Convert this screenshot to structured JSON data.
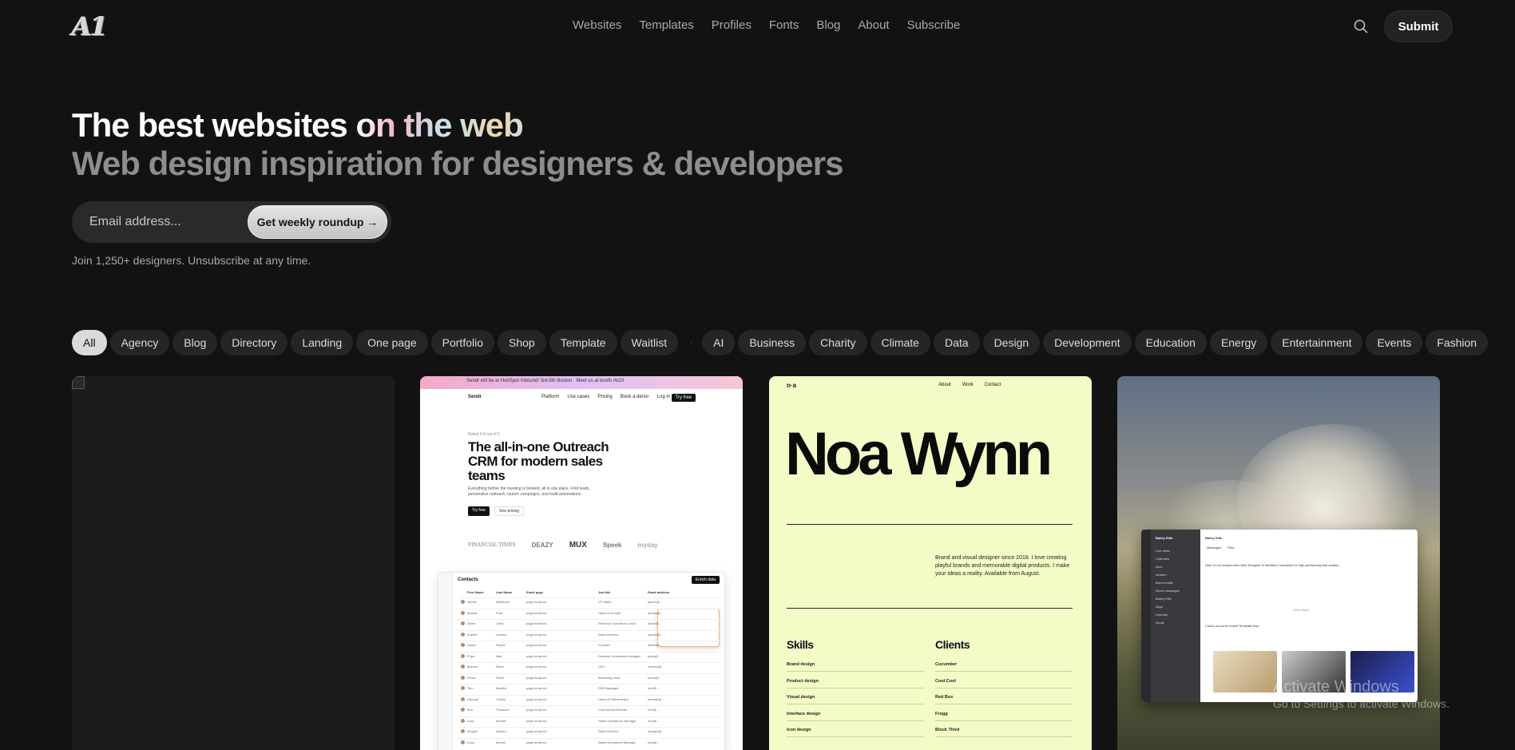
{
  "header": {
    "logo": "A1",
    "nav": [
      "Websites",
      "Templates",
      "Profiles",
      "Fonts",
      "Blog",
      "About",
      "Subscribe"
    ],
    "search_icon": "search-icon",
    "submit_label": "Submit"
  },
  "hero": {
    "title_part1": "The best websites ",
    "title_part2": "on the web",
    "subtitle": "Web design inspiration for designers & developers",
    "email_placeholder": "Email address...",
    "cta_label": "Get weekly roundup →",
    "note": "Join 1,250+ designers. Unsubscribe at any time."
  },
  "filters": {
    "types": [
      "All",
      "Agency",
      "Blog",
      "Directory",
      "Landing",
      "One page",
      "Portfolio",
      "Shop",
      "Template",
      "Waitlist"
    ],
    "separator": "·",
    "categories": [
      "AI",
      "Business",
      "Charity",
      "Climate",
      "Data",
      "Design",
      "Development",
      "Education",
      "Energy",
      "Entertainment",
      "Events",
      "Fashion"
    ],
    "active": "All"
  },
  "cards": {
    "sendr": {
      "banner": "Sendr will be at HubSpot Inbound! 3rd-5th Boston · Meet us at booth #b23",
      "brand": "Sendr",
      "nav": [
        "Platform",
        "Use cases",
        "Pricing",
        "Book a demo"
      ],
      "login": "Log in",
      "try": "Try free",
      "kicker": "Rated 4.9 out of 5",
      "headline": "The all-in-one Outreach CRM for modern sales teams",
      "description": "Everything before the meeting is booked, all in one place. Find leads, personalize outreach, launch campaigns, and build automations.",
      "primary_btn": "Try free",
      "secondary_btn": "See pricing",
      "logos": [
        "FINANCIAL TIMES",
        "DEAZY",
        "MUX",
        "Speek",
        "myday"
      ],
      "app_title": "Contacts",
      "app_action": "Enrich data",
      "columns": [
        "First Name",
        "Last Name",
        "Email page",
        "Job title",
        "Email address"
      ],
      "rows": [
        [
          "James",
          "Whitmore",
          "page.email.ai/...",
          "VP Sales",
          "james@..."
        ],
        [
          "Amelia",
          "Ford",
          "page.email.ai/...",
          "Head of Growth",
          "amelia@..."
        ],
        [
          "Oliver",
          "Chen",
          "page.email.ai/...",
          "Revenue Operations Lead",
          "oliver@..."
        ],
        [
          "Sophie",
          "Laurent",
          "page.email.ai/...",
          "Sales Director",
          "sophie@..."
        ],
        [
          "Daniel",
          "Reyes",
          "page.email.ai/...",
          "Founder",
          "daniel@..."
        ],
        [
          "Priya",
          "Nair",
          "page.email.ai/...",
          "Demand Generation Manager",
          "priya@..."
        ],
        [
          "Marcus",
          "Reed",
          "page.email.ai/...",
          "CEO",
          "marcus@..."
        ],
        [
          "Elena",
          "Rossi",
          "page.email.ai/...",
          "Marketing Lead",
          "elena@..."
        ],
        [
          "Tom",
          "Bradley",
          "page.email.ai/...",
          "SDR Manager",
          "tom@..."
        ],
        [
          "Hannah",
          "Collins",
          "page.email.ai/...",
          "Head of Partnerships",
          "hannah@..."
        ],
        [
          "Ben",
          "Thomson",
          "page.email.ai/...",
          "Commercial Director",
          "ben@..."
        ],
        [
          "Lucy",
          "Morrell",
          "page.email.ai/...",
          "Sales Operations Manager",
          "lucy@..."
        ],
        [
          "Imogen",
          "Ahmed",
          "page.email.ai/...",
          "Sales Director",
          "imogen@..."
        ],
        [
          "Luca",
          "Morelli",
          "page.email.ai/...",
          "Sales Operations Manager",
          "luca@..."
        ]
      ]
    },
    "noa": {
      "logo": "n·a",
      "nav": [
        "About",
        "Work",
        "Contact"
      ],
      "name": "Noa Wynn",
      "bio": "Brand and visual designer since 2018. I love creating playful brands and memorable digital products. I make your ideas a reality. Available from August.",
      "skills_heading": "Skills",
      "clients_heading": "Clients",
      "skills": [
        "Brand design",
        "Product design",
        "Visual design",
        "Interface design",
        "Icon design"
      ],
      "clients": [
        "Cucumber",
        "Cool Cool",
        "Red Box",
        "Frogg",
        "Block Third"
      ]
    },
    "app": {
      "user": "Bailey Eilth",
      "side_items": [
        "Live video",
        "Channels",
        "work",
        "random",
        "team-emails",
        "Direct messages",
        "Bailey Eilth",
        "Apps",
        "LinkedIn",
        "Gmail"
      ],
      "tabs": [
        "Messages",
        "Files"
      ],
      "message1": "Hey! I'm an independent Web Designer & Webflow Consultant for high-performing web studios.",
      "message2": "Check out some recent Template links",
      "reply_label": "Other facts"
    }
  },
  "system": {
    "watermark_title": "Activate Windows",
    "watermark_sub": "Go to Settings to activate Windows."
  }
}
